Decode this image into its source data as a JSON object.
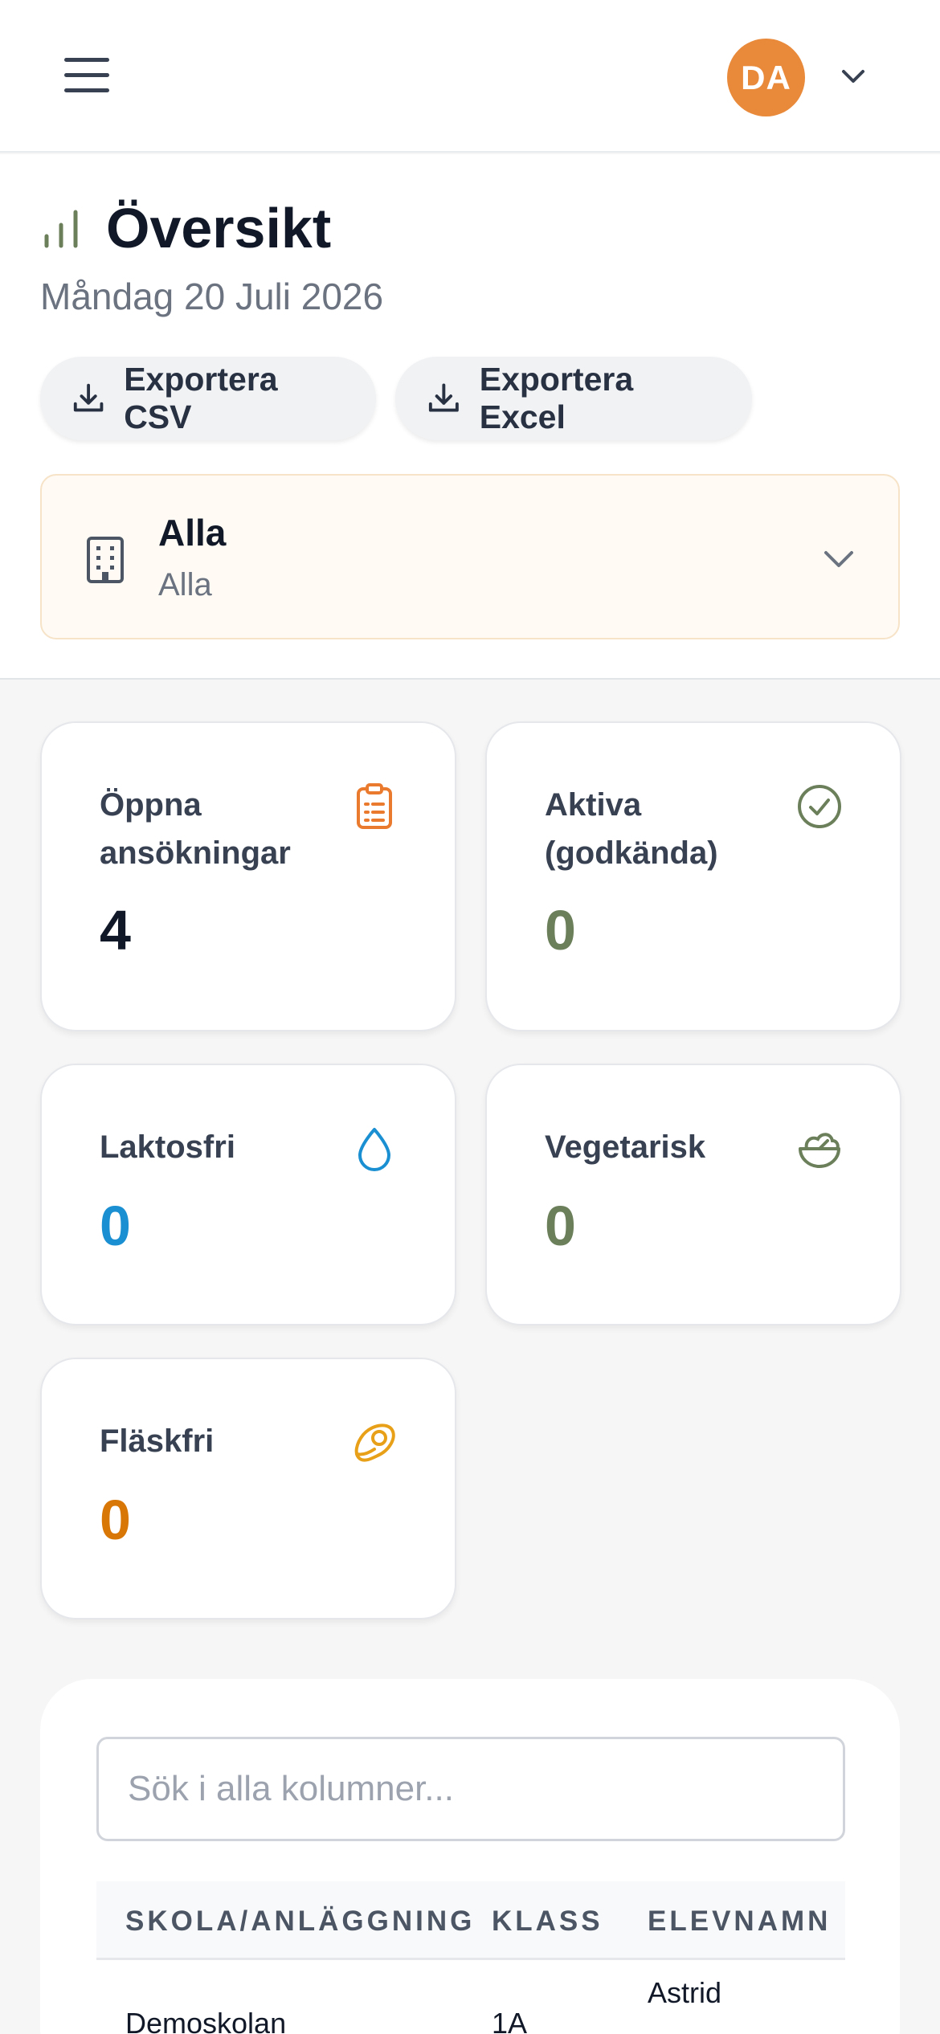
{
  "topbar": {
    "avatar_initials": "DA"
  },
  "header": {
    "title": "Översikt",
    "date": "Måndag 20 Juli 2026",
    "export_csv_label": "Exportera CSV",
    "export_excel_label": "Exportera Excel"
  },
  "selector": {
    "title": "Alla",
    "subtitle": "Alla"
  },
  "stats": {
    "open": {
      "label": "Öppna ansökningar",
      "value": "4",
      "color": "#111827",
      "icon": "clipboard-icon"
    },
    "active": {
      "label": "Aktiva (godkända)",
      "value": "0",
      "color": "#6b7f5a",
      "icon": "check-circle-icon"
    },
    "lactose": {
      "label": "Laktosfri",
      "value": "0",
      "color": "#1a8fd1",
      "icon": "droplet-icon"
    },
    "veg": {
      "label": "Vegetarisk",
      "value": "0",
      "color": "#6b7f5a",
      "icon": "salad-icon"
    },
    "pork": {
      "label": "Fläskfri",
      "value": "0",
      "color": "#d97706",
      "icon": "meat-icon"
    }
  },
  "table": {
    "search_placeholder": "Sök i alla kolumner...",
    "columns": [
      "SKOLA/ANLÄGGNING",
      "KLASS",
      "ELEVNAMN"
    ],
    "rows": [
      {
        "school": "Demoskolan",
        "class": "1A",
        "student": "Astrid"
      }
    ]
  },
  "colors": {
    "accent": "#e98a3b",
    "selector_bg": "#fffaf3"
  }
}
